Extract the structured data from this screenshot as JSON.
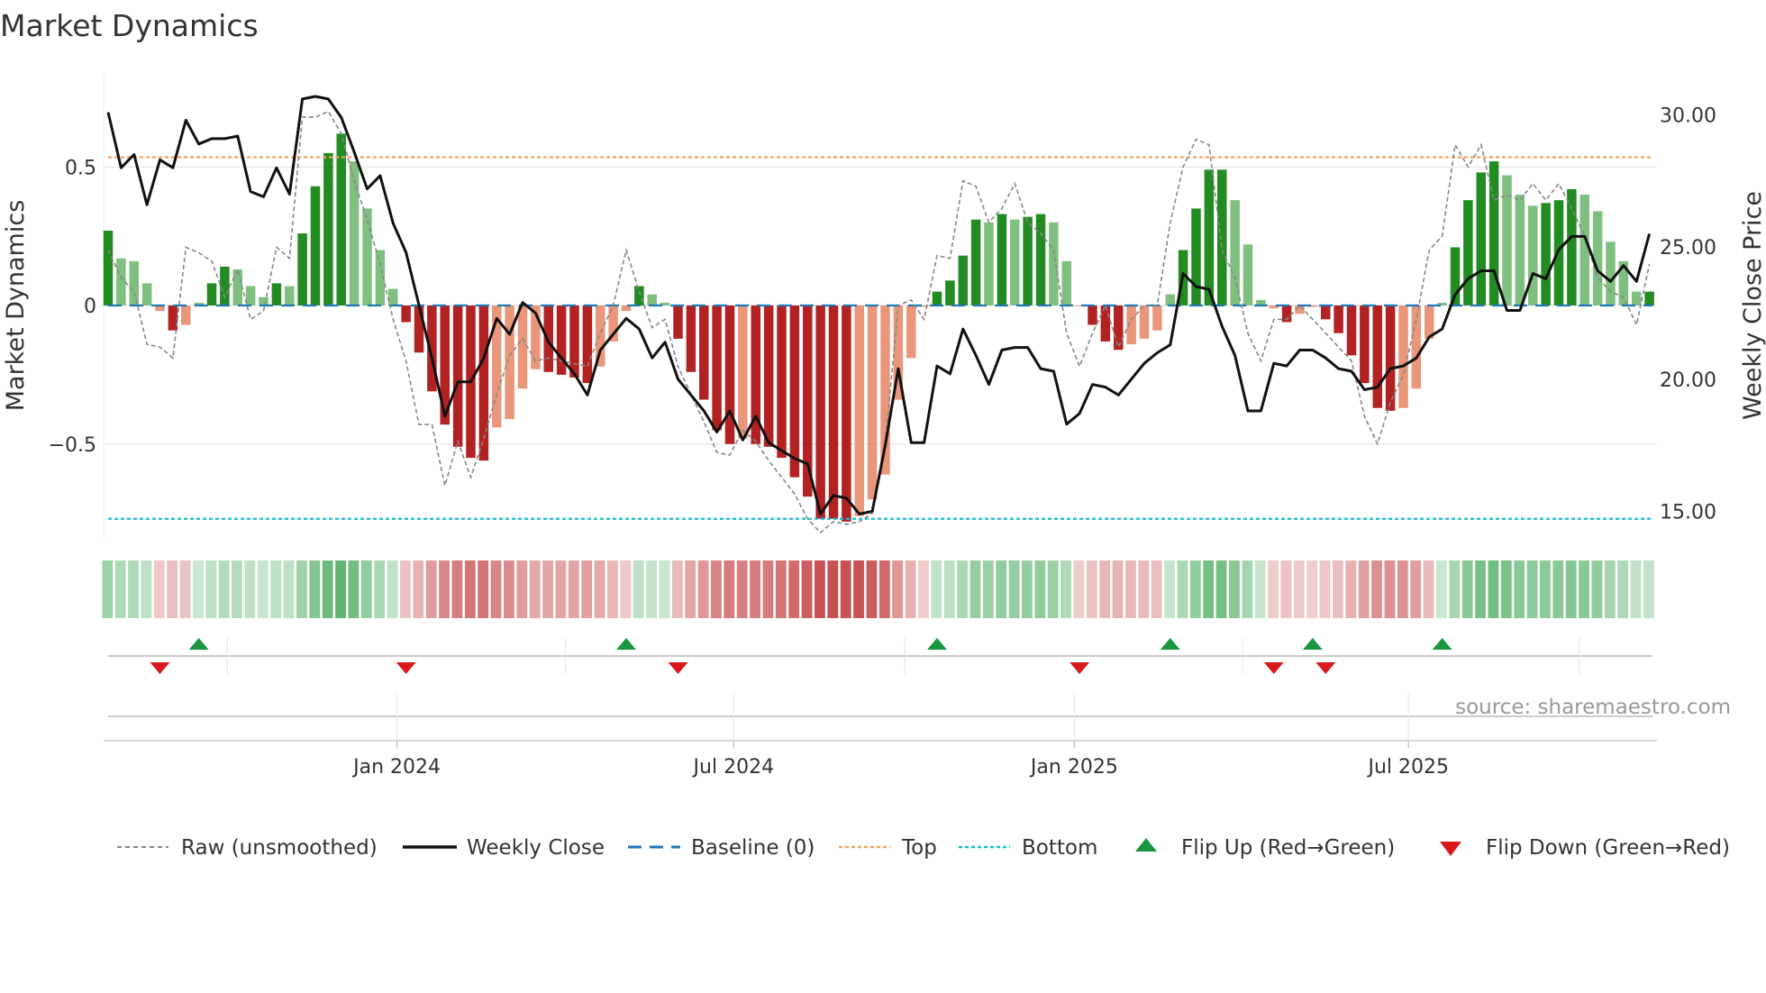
{
  "title": "Market Dynamics",
  "source": "source: sharemaestro.com",
  "chart_data": {
    "type": "bar",
    "title": "Market Dynamics",
    "ylabel_left": "Market Dynamics",
    "ylabel_right": "Weekly Close Price",
    "start_date": "2023-07-28",
    "interval": "weekly",
    "ylim_left": [
      -0.84,
      0.8
    ],
    "ylim_right": [
      13.2,
      31.4
    ],
    "left_ticks": [
      {
        "v": 0.5,
        "label": "0.5"
      },
      {
        "v": 0,
        "label": "0"
      },
      {
        "v": -0.5,
        "label": "−0.5"
      }
    ],
    "right_ticks": [
      {
        "v": 30,
        "label": "30.00"
      },
      {
        "v": 25,
        "label": "25.00"
      },
      {
        "v": 20,
        "label": "20.00"
      },
      {
        "v": 15,
        "label": "15.00"
      }
    ],
    "x_ticks": [
      {
        "week": 22.3,
        "label": "Jan 2024"
      },
      {
        "week": 48.3,
        "label": "Jul 2024"
      },
      {
        "week": 74.6,
        "label": "Jan 2025"
      },
      {
        "week": 100.4,
        "label": "Jul 2025"
      }
    ],
    "minor_weeks": [
      9.2,
      35.3,
      61.5,
      87.6,
      113.6
    ],
    "top_level": 0.535,
    "bottom_level": -0.77,
    "baseline": 0,
    "dynamics": [
      0.27,
      0.17,
      0.16,
      0.08,
      -0.02,
      -0.09,
      -0.07,
      0.01,
      0.08,
      0.14,
      0.13,
      0.07,
      0.03,
      0.08,
      0.07,
      0.26,
      0.43,
      0.55,
      0.62,
      0.52,
      0.35,
      0.2,
      0.06,
      -0.06,
      -0.17,
      -0.31,
      -0.43,
      -0.51,
      -0.55,
      -0.56,
      -0.44,
      -0.41,
      -0.3,
      -0.23,
      -0.24,
      -0.25,
      -0.26,
      -0.28,
      -0.22,
      -0.13,
      -0.02,
      0.07,
      0.04,
      0.01,
      -0.12,
      -0.24,
      -0.34,
      -0.45,
      -0.5,
      -0.48,
      -0.5,
      -0.51,
      -0.55,
      -0.62,
      -0.69,
      -0.77,
      -0.77,
      -0.78,
      -0.76,
      -0.7,
      -0.61,
      -0.34,
      -0.19,
      -0.005,
      0.05,
      0.09,
      0.18,
      0.31,
      0.3,
      0.33,
      0.31,
      0.32,
      0.33,
      0.3,
      0.16,
      -0.003,
      -0.07,
      -0.13,
      -0.16,
      -0.14,
      -0.12,
      -0.09,
      0.04,
      0.2,
      0.35,
      0.49,
      0.49,
      0.38,
      0.22,
      0.02,
      -0.01,
      -0.06,
      -0.03,
      -0.005,
      -0.05,
      -0.1,
      -0.18,
      -0.28,
      -0.37,
      -0.38,
      -0.37,
      -0.3,
      -0.12,
      0.01,
      0.21,
      0.38,
      0.48,
      0.52,
      0.47,
      0.4,
      0.36,
      0.37,
      0.38,
      0.42,
      0.4,
      0.34,
      0.23,
      0.16,
      0.05,
      0.05
    ],
    "raw": [
      0.2,
      0.1,
      0.05,
      -0.14,
      -0.15,
      -0.19,
      0.21,
      0.19,
      0.16,
      0.03,
      0.13,
      -0.05,
      -0.02,
      0.21,
      0.17,
      0.68,
      0.68,
      0.7,
      0.62,
      0.45,
      0.31,
      0.15,
      -0.05,
      -0.2,
      -0.43,
      -0.43,
      -0.65,
      -0.49,
      -0.62,
      -0.48,
      -0.32,
      -0.18,
      -0.12,
      -0.2,
      -0.19,
      -0.2,
      -0.21,
      -0.22,
      -0.1,
      0.0,
      0.2,
      0.05,
      -0.08,
      -0.05,
      -0.22,
      -0.32,
      -0.42,
      -0.53,
      -0.54,
      -0.45,
      -0.49,
      -0.56,
      -0.62,
      -0.68,
      -0.77,
      -0.82,
      -0.78,
      -0.79,
      -0.78,
      -0.75,
      -0.5,
      0.0,
      0.02,
      -0.05,
      0.18,
      0.17,
      0.45,
      0.43,
      0.3,
      0.35,
      0.44,
      0.3,
      0.26,
      0.2,
      -0.1,
      -0.22,
      -0.1,
      0.0,
      -0.15,
      -0.05,
      0.0,
      0.0,
      0.3,
      0.5,
      0.6,
      0.58,
      0.2,
      0.1,
      -0.1,
      -0.2,
      -0.05,
      -0.05,
      0.0,
      -0.05,
      -0.1,
      -0.15,
      -0.2,
      -0.4,
      -0.5,
      -0.35,
      -0.25,
      -0.05,
      0.2,
      0.25,
      0.58,
      0.5,
      0.58,
      0.38,
      0.4,
      0.38,
      0.44,
      0.38,
      0.44,
      0.35,
      0.25,
      0.1,
      0.05,
      0.03,
      -0.07,
      0.15
    ],
    "close": [
      30.1,
      28.0,
      28.5,
      26.6,
      28.3,
      28.0,
      29.8,
      28.9,
      29.1,
      29.1,
      29.2,
      27.1,
      26.9,
      28.0,
      27.0,
      30.6,
      30.7,
      30.6,
      29.9,
      28.6,
      27.2,
      27.7,
      25.9,
      24.8,
      22.8,
      20.8,
      18.6,
      19.9,
      19.9,
      20.8,
      22.3,
      21.7,
      22.9,
      22.5,
      21.4,
      20.8,
      20.2,
      19.4,
      21.1,
      21.7,
      22.3,
      21.9,
      20.8,
      21.4,
      20.0,
      19.4,
      18.8,
      18.0,
      18.8,
      17.7,
      18.6,
      17.6,
      17.3,
      17.0,
      16.8,
      14.9,
      15.6,
      15.5,
      14.9,
      15.0,
      17.5,
      20.4,
      17.6,
      17.6,
      20.5,
      20.2,
      21.9,
      20.9,
      19.8,
      21.1,
      21.2,
      21.2,
      20.4,
      20.3,
      18.3,
      18.7,
      19.8,
      19.7,
      19.4,
      20.0,
      20.6,
      21.0,
      21.3,
      24.0,
      23.5,
      23.4,
      22.0,
      20.9,
      18.8,
      18.8,
      20.6,
      20.5,
      21.1,
      21.1,
      20.8,
      20.4,
      20.3,
      19.6,
      19.7,
      20.4,
      20.5,
      20.8,
      21.6,
      21.9,
      23.2,
      23.8,
      24.1,
      24.1,
      22.6,
      22.6,
      24.0,
      23.8,
      24.9,
      25.4,
      25.4,
      24.1,
      23.7,
      24.3,
      23.7,
      25.5
    ],
    "flip_up_weeks": [
      7,
      40,
      64,
      82,
      93,
      103
    ],
    "flip_down_weeks": [
      4,
      23,
      44,
      75,
      90,
      94
    ],
    "legend": {
      "raw": "Raw (unsmoothed)",
      "close": "Weekly Close",
      "baseline": "Baseline (0)",
      "top": "Top",
      "bottom": "Bottom",
      "flip_up": "Flip Up (Red→Green)",
      "flip_down": "Flip Down (Green→Red)"
    },
    "colors": {
      "green_dark": "#228b22",
      "green_light": "#7fbf7f",
      "red_dark": "#b22222",
      "red_light": "#e9967a",
      "close": "#111111",
      "raw": "#888888",
      "baseline": "#1f77b4",
      "top": "#f4a460",
      "bottom": "#17becf",
      "flip_up": "#1a9641",
      "flip_down": "#d7191c"
    }
  }
}
